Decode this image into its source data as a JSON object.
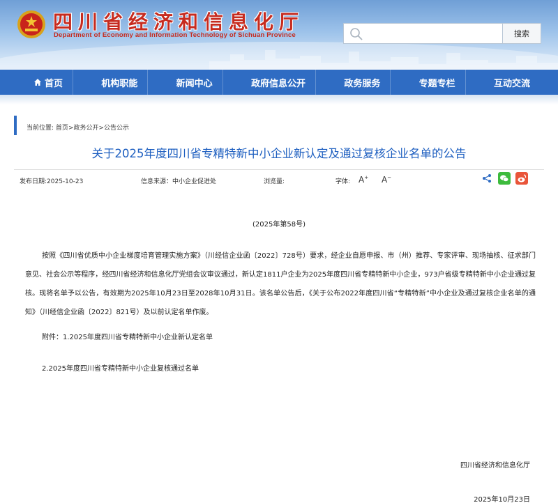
{
  "header": {
    "site_title": "四川省经济和信息化厅",
    "site_subtitle": "Department of Economy and Information Technology of Sichuan Province",
    "search_placeholder": "",
    "search_button": "搜索"
  },
  "nav": {
    "items": [
      {
        "label": "首页",
        "icon": "home-icon"
      },
      {
        "label": "机构职能"
      },
      {
        "label": "新闻中心"
      },
      {
        "label": "政府信息公开"
      },
      {
        "label": "政务服务"
      },
      {
        "label": "专题专栏"
      },
      {
        "label": "互动交流"
      }
    ]
  },
  "breadcrumb": {
    "prefix": "当前位置:",
    "items": [
      "首页",
      "政务公开",
      "公告公示"
    ],
    "separator": ">"
  },
  "article": {
    "title": "关于2025年度四川省专精特新中小企业新认定及通过复核企业名单的公告",
    "publish_date": "发布日期:2025-10-23",
    "source": "信息来源：中小企业促进处",
    "views": "浏览量:",
    "font_label": "字体:",
    "font_increase": "A",
    "font_decrease": "A",
    "doc_number": "(2025年第58号)",
    "paragraph": "按照《四川省优质中小企业梯度培育管理实施方案》（川经信企业函〔2022〕728号）要求，经企业自愿申报、市（州）推荐、专家评审、现场抽核、征求部门意见、社会公示等程序，经四川省经济和信息化厅党组会议审议通过，新认定1811户企业为2025年度四川省专精特新中小企业，973户省级专精特新中小企业通过复核。现将名单予以公告，有效期为2025年10月23日至2028年10月31日。该名单公告后，《关于公布2022年度四川省“专精特新”中小企业及通过复核企业名单的通知》（川经信企业函〔2022〕821号）及以前认定名单作废。",
    "attachment_1": "附件：1.2025年度四川省专精特新中小企业新认定名单",
    "attachment_2": "2.2025年度四川省专精特新中小企业复核通过名单",
    "sign_org": "四川省经济和信息化厅",
    "sign_date": "2025年10月23日"
  },
  "colors": {
    "brand_blue": "#2f6cc3",
    "title_red": "#c62b1f",
    "title_blue": "#1e5fc0",
    "wechat_green": "#3dbb3d",
    "weibo_red": "#e9553a"
  }
}
